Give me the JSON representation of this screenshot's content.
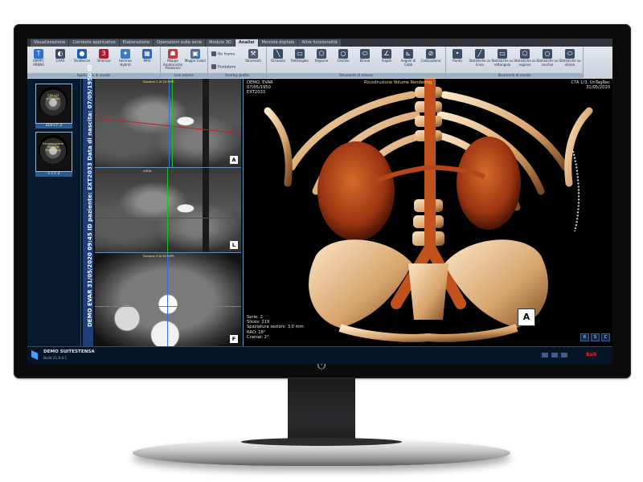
{
  "app": {
    "tabs": [
      "Visualizzazione",
      "Contesto applicativo",
      "Elaborazione",
      "Operazioni sulle serie",
      "Modulo 3D",
      "Analisi",
      "Moviola digitale",
      "Altre funzionalità"
    ],
    "active_tab": "Analisi"
  },
  "ribbon": {
    "group1": {
      "label": "Applicativi di analisi",
      "buttons": [
        "OMPPC ARENA",
        "CAAS",
        "TeraRecon",
        "3mensio",
        "Hemnes Hybrid",
        "MRV"
      ]
    },
    "group2": {
      "label": "Link esterni",
      "buttons": [
        "Mappe Anatomiche Proiezioni",
        "Mappe Colori"
      ]
    },
    "group3": {
      "label": "Overlay grafici",
      "buttons": [
        "No frame",
        "Puntatore",
        "Strumenti"
      ]
    },
    "group4": {
      "label": "Strumenti di misura",
      "buttons": [
        "Distanza",
        "Rettangolo",
        "Regione",
        "Cerchio",
        "Ellisse",
        "Angoli",
        "Angolo di Cobb",
        "Calibrazione"
      ]
    },
    "group5": {
      "label": "Strumenti di analisi",
      "buttons": [
        "Punto",
        "Statistiche su linea",
        "Statistiche su rettangolo",
        "Statistiche su regione",
        "Statistiche su cerchio",
        "Statistiche su ellisse"
      ]
    }
  },
  "thumbnails": [
    {
      "overlay": "CTA 1/3 UnTagRec",
      "caption": "219 CT: 2"
    },
    {
      "overlay": "Ricostruzione Volume Rendering",
      "caption": "1 CT: 2"
    }
  ],
  "vertical_banner": "DEMO EVAR 31/05/2020 09:45 ID paziente: EXT2033 Data di nascita: 07/05/1950 ID",
  "mpr_views": [
    {
      "caption": "Sezione 1 di 20 MPR",
      "orientation": "A"
    },
    {
      "caption": "AXIAL",
      "orientation": "L"
    },
    {
      "caption": "Sezione 9 di 63 MPR",
      "orientation": "F"
    }
  ],
  "volume_render": {
    "top_left": "DEMO, EVAR\n07/05/1950\nEXT2033",
    "top_center": "Ricostruzione Volume Rendering",
    "top_right": "CTA 1/3, UnTagRec\n31/05/2020",
    "bottom_left": "Serie: 2\nSlices: 219\nSpaziatura sezioni: 3,0 mm\nRAO: 18°\nCranial: 2°",
    "orientation_cube": "A",
    "buttons": [
      "R",
      "S",
      "C"
    ]
  },
  "status": {
    "title": "DEMO SUITESTENSA",
    "build": "Build 21.6.4.1",
    "brand": "Esit"
  },
  "colors": {
    "accent": "#1d3f78",
    "crosshair_red": "#c02020",
    "crosshair_green": "#19c020",
    "crosshair_blue": "#2f6fe0",
    "bone": "#f4d7b0",
    "vessel": "#b9461b"
  }
}
